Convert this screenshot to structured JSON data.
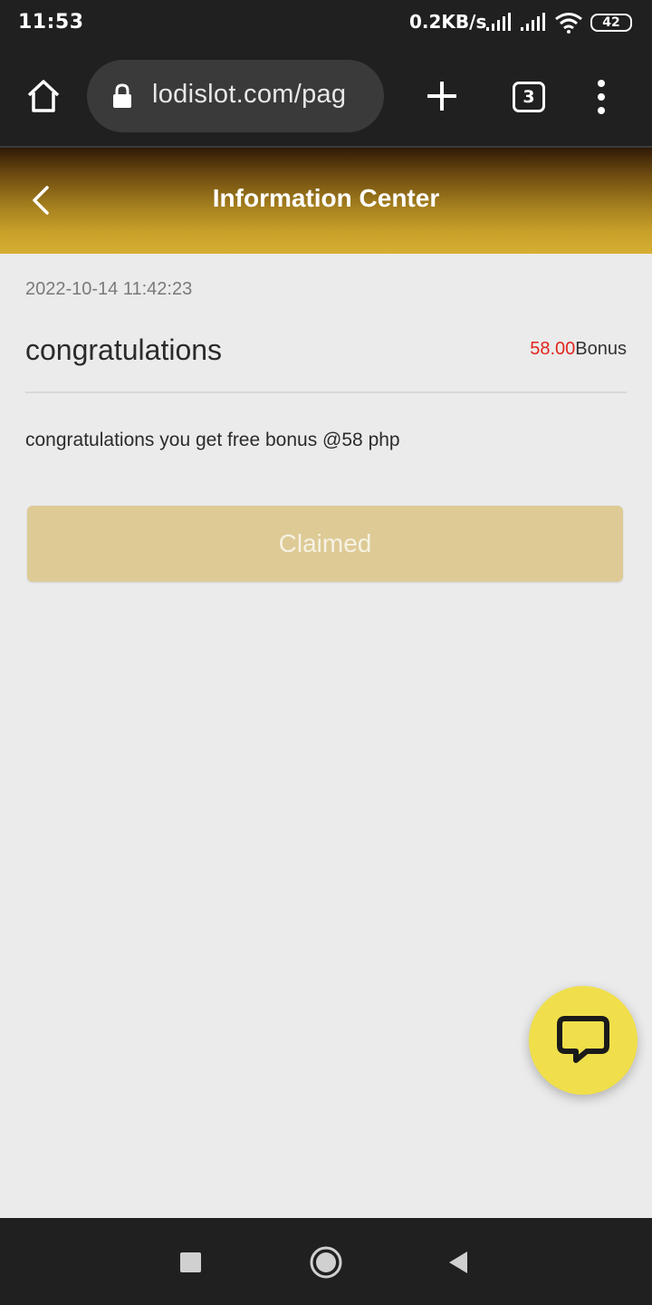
{
  "status_bar": {
    "time": "11:53",
    "network_speed": "0.2KB/s",
    "battery": "42"
  },
  "browser": {
    "url": "lodislot.com/pag",
    "tab_count": "3",
    "icons": [
      "home-icon",
      "lock-icon",
      "new-tab-icon",
      "tabs-icon",
      "menu-icon"
    ]
  },
  "header": {
    "title": "Information Center"
  },
  "message": {
    "date": "2022-10-14 11:42:23",
    "title": "congratulations",
    "amount": "58.00",
    "amount_unit": "Bonus",
    "body": "congratulations you get free bonus @58 php",
    "button_label": "Claimed"
  },
  "colors": {
    "header_gradient_top": "#2f1a05",
    "header_gradient_bottom": "#d6ae31",
    "amount": "#e1261c",
    "claim_button": "#ddca95",
    "chat_fab": "#f0df4b"
  }
}
